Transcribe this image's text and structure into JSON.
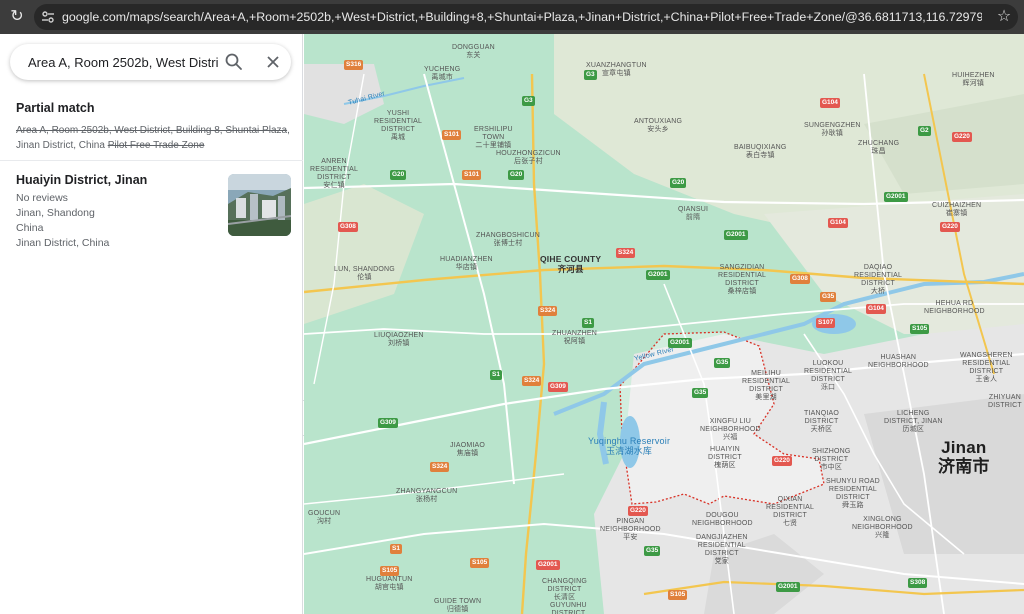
{
  "browser": {
    "url": "google.com/maps/search/Area+A,+Room+2502b,+West+District,+Building+8,+Shuntai+Plaza,+Jinan+District,+China+Pilot+Free+Trade+Zone/@36.6811713,116.7297908,11z/data=!3m1!4..."
  },
  "search": {
    "value": "Area A, Room 2502b, West District, B"
  },
  "partial_match": {
    "title": "Partial match",
    "struck_1": "Area A, Room 2502b, West District, Building 8, Shuntai Plaza",
    "comma": ",",
    "plain": "Jinan District, China",
    "struck_2": "Pilot Free Trade Zone"
  },
  "result": {
    "title": "Huaiyin District, Jinan",
    "reviews": "No reviews",
    "line1": "Jinan, Shandong",
    "line2": "China",
    "line3": "Jinan District, China"
  },
  "map": {
    "colors": {
      "land": "#b9e4cc",
      "water": "#8fc8e8",
      "urban": "#e6e6e6",
      "highway": "#f3c64f",
      "road": "#ffffff",
      "boundary": "#d93025"
    },
    "places": [
      {
        "id": "dongguan",
        "name": "DONGGUAN",
        "zh": "东关"
      },
      {
        "id": "yucheng",
        "name": "YUCHENG",
        "zh": "禹城市"
      },
      {
        "id": "xuanzhang",
        "name": "XUANZHANGTUN",
        "zh": "宣章屯镇"
      },
      {
        "id": "huihezhen",
        "name": "HUIHEZHEN",
        "zh": "辉河镇"
      },
      {
        "id": "yushi",
        "name": "YUSHI RESIDENTIAL DISTRICT",
        "zh": "禹城"
      },
      {
        "id": "ershilipu",
        "name": "ERSHILIPU TOWN",
        "zh": "二十里铺镇"
      },
      {
        "id": "antouxiang",
        "name": "ANTOUXIANG",
        "zh": "安头乡"
      },
      {
        "id": "sungengzhen",
        "name": "SUNGENGZHEN",
        "zh": "孙耿镇"
      },
      {
        "id": "houzhong",
        "name": "HOUZHONGZICUN",
        "zh": "后张子村"
      },
      {
        "id": "baibu",
        "name": "BAIBUQIXIANG",
        "zh": "表白寺镇"
      },
      {
        "id": "zhuchang",
        "name": "ZHUCHANG",
        "zh": "珠昌"
      },
      {
        "id": "anren",
        "name": "ANREN RESIDENTIAL DISTRICT",
        "zh": "安仁镇"
      },
      {
        "id": "qiansui",
        "name": "QIANSUI",
        "zh": "前隋"
      },
      {
        "id": "cuizhai",
        "name": "CUIZHAIZHEN",
        "zh": "崔寨镇"
      },
      {
        "id": "zhangboshi",
        "name": "ZHANGBOSHICUN",
        "zh": "张博士村"
      },
      {
        "id": "lun",
        "name": "LUN, SHANDONG",
        "zh": "伦镇"
      },
      {
        "id": "huadian",
        "name": "HUADIANZHEN",
        "zh": "华店镇"
      },
      {
        "id": "sangzi",
        "name": "SANGZIDIAN RESIDENTIAL DISTRICT",
        "zh": "桑梓店镇"
      },
      {
        "id": "daqiao",
        "name": "DAQIAO RESIDENTIAL DISTRICT",
        "zh": "大桥"
      },
      {
        "id": "hehua",
        "name": "HEHUA RD NEIGHBORHOOD",
        "zh": "荷花路"
      },
      {
        "id": "liuqiao",
        "name": "LIUQIAOZHEN",
        "zh": "刘桥镇"
      },
      {
        "id": "zhuanzhen",
        "name": "ZHUANZHEN",
        "zh": "祝阿镇"
      },
      {
        "id": "meilihu",
        "name": "MEILIHU RESIDENTIAL DISTRICT",
        "zh": "美里湖"
      },
      {
        "id": "luokou",
        "name": "LUOKOU RESIDENTIAL DISTRICT",
        "zh": "泺口"
      },
      {
        "id": "huashan",
        "name": "HUASHAN NEIGHBORHOOD",
        "zh": ""
      },
      {
        "id": "wangshe",
        "name": "WANGSHEREN RESIDENTIAL DISTRICT",
        "zh": "王舍人"
      },
      {
        "id": "xingfu",
        "name": "XINGFU LIU NEIGHBORHOOD",
        "zh": "兴福"
      },
      {
        "id": "tianqiao",
        "name": "TIANQIAO DISTRICT",
        "zh": "天桥区"
      },
      {
        "id": "licheng",
        "name": "LICHENG DISTRICT, JINAN",
        "zh": "历城区"
      },
      {
        "id": "zhiyuan",
        "name": "ZHIYUAN DISTRICT",
        "zh": ""
      },
      {
        "id": "jiaomiao",
        "name": "JIAOMIAO",
        "zh": "焦庙镇"
      },
      {
        "id": "huaiyin",
        "name": "HUAIYIN DISTRICT",
        "zh": "槐荫区"
      },
      {
        "id": "shizhong",
        "name": "SHIZHONG DISTRICT",
        "zh": "市中区"
      },
      {
        "id": "shunyu",
        "name": "SHUNYU ROAD RESIDENTIAL DISTRICT",
        "zh": "舜玉路"
      },
      {
        "id": "qixian",
        "name": "QIXIAN RESIDENTIAL DISTRICT",
        "zh": "七贤"
      },
      {
        "id": "xinglong",
        "name": "XINGLONG NEIGHBORHOOD",
        "zh": "兴隆"
      },
      {
        "id": "goucun",
        "name": "GOUCUN",
        "zh": "沟村"
      },
      {
        "id": "zhangyang",
        "name": "ZHANGYANGCUN",
        "zh": "张杨村"
      },
      {
        "id": "pingan",
        "name": "PINGAN NEIGHBORHOOD",
        "zh": "平安"
      },
      {
        "id": "dougou",
        "name": "DOUGOU NEIGHBORHOOD",
        "zh": ""
      },
      {
        "id": "dangjia",
        "name": "DANGJIAZHEN RESIDENTIAL DISTRICT",
        "zh": "党家"
      },
      {
        "id": "changqing",
        "name": "CHANGQING DISTRICT",
        "zh": "长清区"
      },
      {
        "id": "guyunhu",
        "name": "GUYUNHU DISTRICT",
        "zh": ""
      },
      {
        "id": "huguantun",
        "name": "HUGUANTUN",
        "zh": "胡官屯镇"
      },
      {
        "id": "guide",
        "name": "GUIDE TOWN",
        "zh": "归德镇"
      }
    ],
    "county": {
      "name": "QIHE COUNTY",
      "zh": "齐河县"
    },
    "reservoir": {
      "name": "Yuqinghu Reservoir",
      "zh": "玉清湖水库"
    },
    "city": {
      "name": "Jinan",
      "zh": "济南市"
    },
    "rivers": {
      "tuhai": "Tuhai River",
      "yellow": "Yellow River"
    },
    "routes": [
      {
        "id": "s316",
        "label": "S316",
        "kind": "o"
      },
      {
        "id": "g3a",
        "label": "G3",
        "kind": "g"
      },
      {
        "id": "g3b",
        "label": "G3",
        "kind": "g"
      },
      {
        "id": "s101a",
        "label": "S101",
        "kind": "o"
      },
      {
        "id": "s101b",
        "label": "S101",
        "kind": "o"
      },
      {
        "id": "g20a",
        "label": "G20",
        "kind": "g"
      },
      {
        "id": "g20b",
        "label": "G20",
        "kind": "g"
      },
      {
        "id": "g20c",
        "label": "G20",
        "kind": "g"
      },
      {
        "id": "g104a",
        "label": "G104",
        "kind": "r"
      },
      {
        "id": "g104b",
        "label": "G104",
        "kind": "r"
      },
      {
        "id": "g104c",
        "label": "G104",
        "kind": "r"
      },
      {
        "id": "g2",
        "label": "G2",
        "kind": "g"
      },
      {
        "id": "g220a",
        "label": "G220",
        "kind": "r"
      },
      {
        "id": "g220b",
        "label": "G220",
        "kind": "r"
      },
      {
        "id": "g220c",
        "label": "G220",
        "kind": "r"
      },
      {
        "id": "g220d",
        "label": "G220",
        "kind": "r"
      },
      {
        "id": "g2001a",
        "label": "G2001",
        "kind": "g"
      },
      {
        "id": "g2001b",
        "label": "G2001",
        "kind": "g"
      },
      {
        "id": "g2001c",
        "label": "G2001",
        "kind": "g"
      },
      {
        "id": "g2001d",
        "label": "G2001",
        "kind": "g"
      },
      {
        "id": "g2001e",
        "label": "G2001",
        "kind": "g"
      },
      {
        "id": "g2001f",
        "label": "G2001",
        "kind": "g"
      },
      {
        "id": "s308a",
        "label": "S308",
        "kind": "o"
      },
      {
        "id": "g308a",
        "label": "G308",
        "kind": "r"
      },
      {
        "id": "g308b",
        "label": "G308",
        "kind": "r"
      },
      {
        "id": "s324a",
        "label": "S324",
        "kind": "o"
      },
      {
        "id": "s324b",
        "label": "S324",
        "kind": "o"
      },
      {
        "id": "s324c",
        "label": "S324",
        "kind": "o"
      },
      {
        "id": "s324d",
        "label": "S324",
        "kind": "o"
      },
      {
        "id": "s1a",
        "label": "S1",
        "kind": "g"
      },
      {
        "id": "s1b",
        "label": "S1",
        "kind": "g"
      },
      {
        "id": "s1c",
        "label": "S1",
        "kind": "g"
      },
      {
        "id": "g309a",
        "label": "G309",
        "kind": "r"
      },
      {
        "id": "g309b",
        "label": "G309",
        "kind": "r"
      },
      {
        "id": "s107",
        "label": "S107",
        "kind": "o"
      },
      {
        "id": "g35a",
        "label": "G35",
        "kind": "g"
      },
      {
        "id": "g35b",
        "label": "G35",
        "kind": "g"
      },
      {
        "id": "g35c",
        "label": "G35",
        "kind": "g"
      },
      {
        "id": "g35d",
        "label": "G35",
        "kind": "g"
      },
      {
        "id": "s105a",
        "label": "S105",
        "kind": "o"
      },
      {
        "id": "s105b",
        "label": "S105",
        "kind": "o"
      },
      {
        "id": "s105c",
        "label": "S105",
        "kind": "o"
      },
      {
        "id": "s105d",
        "label": "S105",
        "kind": "o"
      }
    ]
  }
}
